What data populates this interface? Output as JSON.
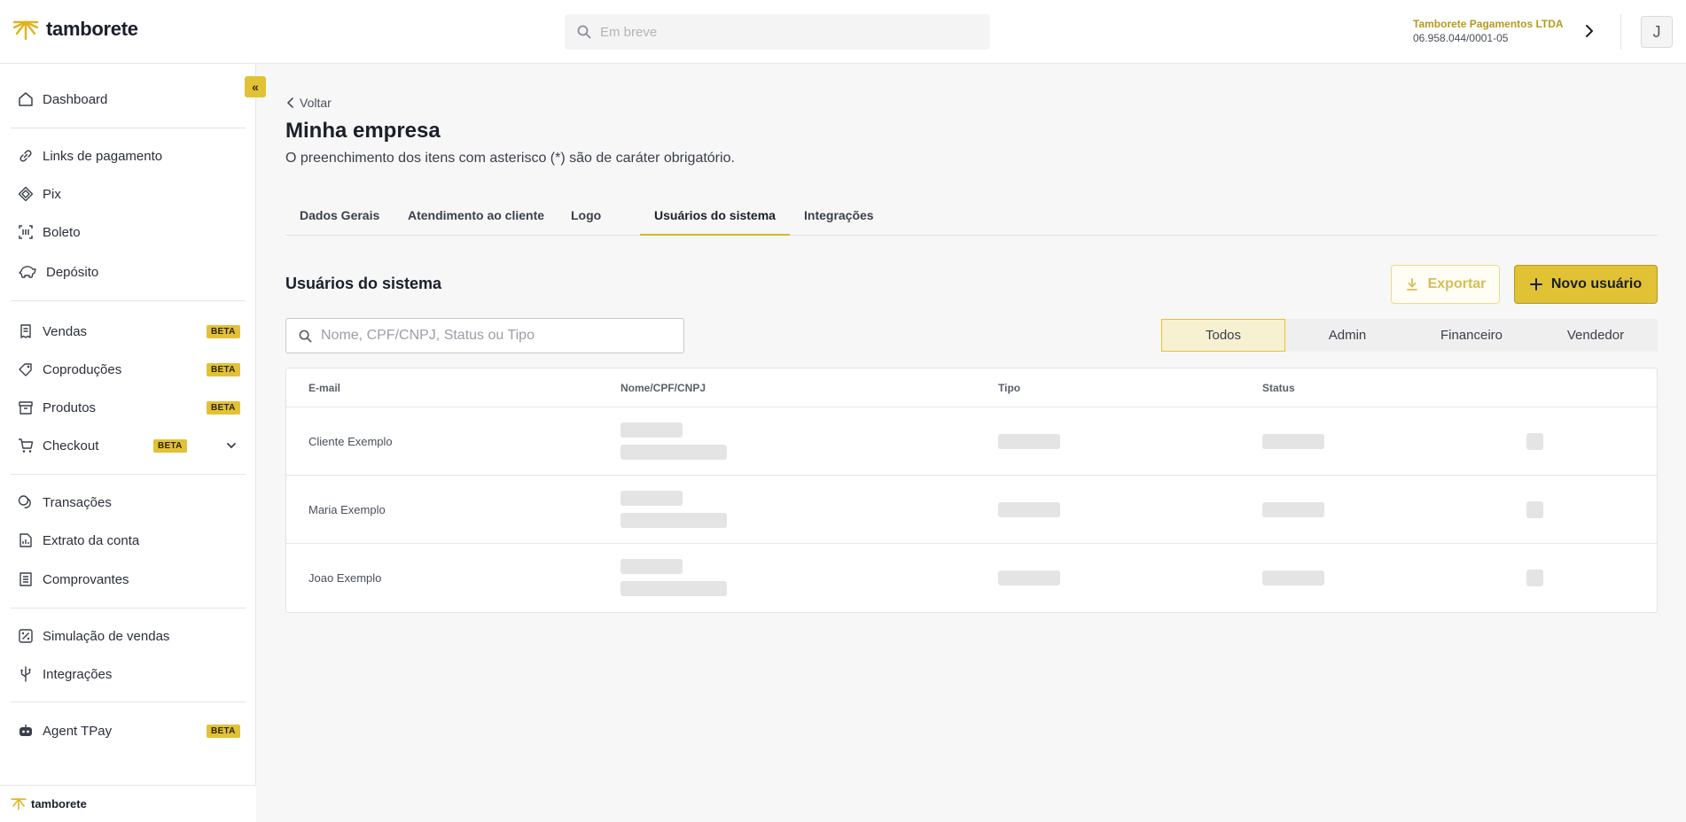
{
  "header": {
    "brand": "tamborete",
    "search_placeholder": "Em breve",
    "company_name": "Tamborete Pagamentos LTDA",
    "company_cnpj": "06.958.044/0001-05",
    "avatar_initial": "J"
  },
  "sidebar": {
    "collapse_label": "«",
    "items": [
      {
        "label": "Dashboard",
        "icon": "home-icon"
      },
      {
        "label": "Links de pagamento",
        "icon": "link-icon"
      },
      {
        "label": "Pix",
        "icon": "pix-icon"
      },
      {
        "label": "Boleto",
        "icon": "barcode-icon"
      },
      {
        "label": "Depósito",
        "icon": "piggy-bank-icon"
      },
      {
        "label": "Vendas",
        "icon": "receipt-icon",
        "badge": "BETA"
      },
      {
        "label": "Coproduções",
        "icon": "tag-icon",
        "badge": "BETA"
      },
      {
        "label": "Produtos",
        "icon": "box-icon",
        "badge": "BETA"
      },
      {
        "label": "Checkout",
        "icon": "cart-icon",
        "badge": "BETA"
      },
      {
        "label": "Transações",
        "icon": "coins-icon"
      },
      {
        "label": "Extrato da conta",
        "icon": "statement-icon"
      },
      {
        "label": "Comprovantes",
        "icon": "list-icon"
      },
      {
        "label": "Simulação de vendas",
        "icon": "percent-icon"
      },
      {
        "label": "Integrações",
        "icon": "usb-icon"
      },
      {
        "label": "Agent TPay",
        "icon": "robot-icon",
        "badge": "BETA"
      }
    ],
    "footer_brand": "tamborete"
  },
  "main": {
    "back_label": "Voltar",
    "title": "Minha empresa",
    "subtitle": "O preenchimento dos itens com asterisco (*) são de caráter obrigatório.",
    "tabs": [
      {
        "label": "Dados Gerais",
        "active": false
      },
      {
        "label": "Atendimento ao cliente",
        "active": false
      },
      {
        "label": "Logo",
        "active": false
      },
      {
        "label": "Usuários do sistema",
        "active": true
      },
      {
        "label": "Integrações",
        "active": false
      }
    ],
    "section_title": "Usuários do sistema",
    "export_label": "Exportar",
    "new_user_label": "Novo usuário",
    "search_placeholder": "Nome, CPF/CNPJ, Status ou Tipo",
    "filters": [
      {
        "label": "Todos",
        "active": true
      },
      {
        "label": "Admin",
        "active": false
      },
      {
        "label": "Financeiro",
        "active": false
      },
      {
        "label": "Vendedor",
        "active": false
      }
    ],
    "table": {
      "columns": [
        "E-mail",
        "Nome/CPF/CNPJ",
        "Tipo",
        "Status"
      ],
      "rows": [
        {
          "email": "Cliente Exemplo"
        },
        {
          "email": "Maria Exemplo"
        },
        {
          "email": "Joao Exemplo"
        }
      ]
    }
  },
  "colors": {
    "accent": "#e2c235",
    "accent_text": "#b59a1e",
    "background": "#f7f7f7"
  }
}
